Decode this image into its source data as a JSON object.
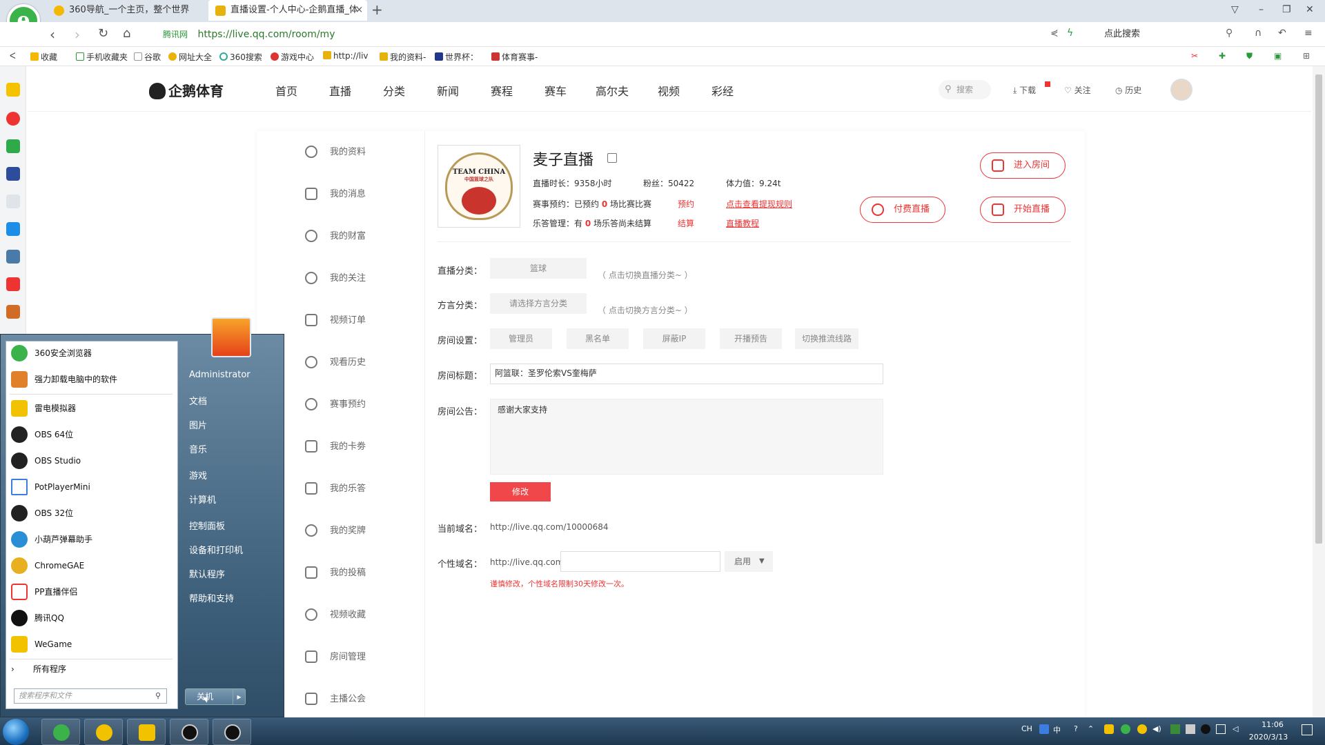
{
  "browser": {
    "tabs": [
      {
        "label": "360导航_一个主页，整个世界"
      },
      {
        "label": "直播设置-个人中心-企鹅直播_体"
      }
    ],
    "address": {
      "source": "腾讯网",
      "url": "https://live.qq.com/room/my"
    },
    "search_placeholder": "点此搜索",
    "bookmarks": [
      "收藏",
      "手机收藏夹",
      "谷歌",
      "网址大全",
      "360搜索",
      "游戏中心",
      "http://liv",
      "我的资料-",
      "世界杯：",
      "体育赛事-"
    ]
  },
  "site": {
    "logo": "企鹅体育",
    "nav": [
      "首页",
      "直播",
      "分类",
      "新闻",
      "赛程",
      "赛车",
      "高尔夫",
      "视频",
      "彩经"
    ],
    "search": "搜索",
    "download": "下载",
    "follow": "关注",
    "history": "历史"
  },
  "sidebar": [
    {
      "label": "我的资料",
      "icon": "user-icon"
    },
    {
      "label": "我的消息",
      "icon": "mail-icon"
    },
    {
      "label": "我的财富",
      "icon": "yen-icon"
    },
    {
      "label": "我的关注",
      "icon": "heart-icon"
    },
    {
      "label": "视频订单",
      "icon": "check-icon"
    },
    {
      "label": "观看历史",
      "icon": "clock-icon"
    },
    {
      "label": "赛事预约",
      "icon": "alarm-icon"
    },
    {
      "label": "我的卡劵",
      "icon": "ticket-icon"
    },
    {
      "label": "我的乐答",
      "icon": "trophy-icon"
    },
    {
      "label": "我的奖牌",
      "icon": "medal-icon"
    },
    {
      "label": "我的投稿",
      "icon": "play-icon"
    },
    {
      "label": "视频收藏",
      "icon": "star-icon"
    },
    {
      "label": "房间管理",
      "icon": "home-icon"
    },
    {
      "label": "主播公会",
      "icon": "handshake-icon"
    }
  ],
  "profile": {
    "logo_text": "TEAM CHINA",
    "logo_sub": "中国篮球之队",
    "name": "麦子直播",
    "duration": "直播时长：9358小时",
    "fans": "粉丝：50422",
    "stamina": "体力值：9.24t",
    "booking_prefix": "赛事预约：已预约 ",
    "booking_count": "0",
    "booking_suffix": " 场比赛比赛",
    "booking_action": "预约",
    "booking_rule": "点击查看提现规则",
    "quiz_prefix": "乐答管理：有 ",
    "quiz_count": "0",
    "quiz_suffix": " 场乐答尚未结算",
    "quiz_action": "结算",
    "tutorial": "直播教程",
    "paid_live": "付费直播",
    "enter_room": "进入房间",
    "start_live": "开始直播"
  },
  "form": {
    "category_label": "直播分类：",
    "category_value": "篮球",
    "category_hint": "（ 点击切换直播分类~ ）",
    "dialect_label": "方言分类：",
    "dialect_value": "请选择方言分类",
    "dialect_hint": "（ 点击切换方言分类~ ）",
    "room_settings_label": "房间设置：",
    "room_settings_buttons": [
      "管理员",
      "黑名单",
      "屏蔽IP",
      "开播预告",
      "切换推流线路"
    ],
    "room_title_label": "房间标题：",
    "room_title_value": "阿篮联：圣罗伦索VS奎梅萨",
    "notice_label": "房间公告：",
    "notice_value": "感谢大家支持",
    "modify_button": "修改",
    "domain_label": "当前域名：",
    "domain_value": "http://live.qq.com/10000684",
    "custom_label": "个性域名：",
    "custom_prefix": "http://live.qq.com",
    "custom_value": "",
    "custom_select": "启用",
    "custom_warning": "谨慎修改，个性域名限制30天修改一次。"
  },
  "start_menu": {
    "programs": [
      "360安全浏览器",
      "强力卸载电脑中的软件",
      "雷电模拟器",
      "OBS 64位",
      "OBS Studio",
      "PotPlayerMini",
      "OBS 32位",
      "小葫芦弹幕助手",
      "ChromeGAE",
      "PP直播伴侣",
      "腾讯QQ",
      "WeGame"
    ],
    "all_programs": "所有程序",
    "search_placeholder": "搜索程序和文件",
    "user": "Administrator",
    "links": [
      "文档",
      "图片",
      "音乐",
      "游戏",
      "计算机",
      "控制面板",
      "设备和打印机",
      "默认程序",
      "帮助和支持"
    ],
    "shutdown": "关机"
  },
  "taskbar": {
    "ime": "CH",
    "ime2": "中",
    "time": "11:06",
    "date": "2020/3/13"
  }
}
